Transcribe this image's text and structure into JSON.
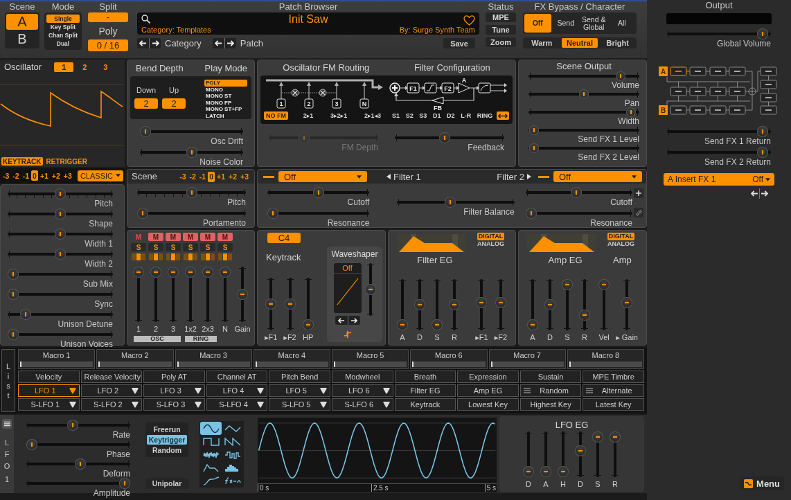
{
  "header": {
    "scene": {
      "title": "Scene",
      "options": [
        {
          "label": "A",
          "selected": true
        },
        {
          "label": "B",
          "selected": false
        }
      ]
    },
    "mode": {
      "title": "Mode",
      "options": [
        {
          "label": "Single",
          "selected": true
        },
        {
          "label": "Key Split",
          "selected": false
        },
        {
          "label": "Chan Split",
          "selected": false
        },
        {
          "label": "Dual",
          "selected": false
        }
      ]
    },
    "split": {
      "title": "Split",
      "value": "-"
    },
    "poly": {
      "title": "Poly",
      "value": "0 / 16"
    },
    "patch_browser": {
      "title": "Patch Browser",
      "patch_name": "Init Saw",
      "category": "Category: Templates",
      "author": "By: Surge Synth Team",
      "favorite": false,
      "nav": [
        {
          "label": "Category"
        },
        {
          "label": "Patch"
        }
      ],
      "save": "Save"
    },
    "status": {
      "title": "Status",
      "buttons": [
        "MPE",
        "Tune",
        "Zoom"
      ]
    },
    "fx_bypass": {
      "title": "FX Bypass / Character",
      "bypass": [
        {
          "label": "Off",
          "selected": true
        },
        {
          "label": "Send",
          "selected": false
        },
        {
          "label": "Send & Global",
          "selected": false
        },
        {
          "label": "All",
          "selected": false
        }
      ],
      "character": [
        {
          "label": "Warm",
          "selected": false
        },
        {
          "label": "Neutral",
          "selected": true
        },
        {
          "label": "Bright",
          "selected": false
        }
      ]
    }
  },
  "oscillator": {
    "title": "Oscillator",
    "tabs": [
      {
        "label": "1",
        "selected": true
      },
      {
        "label": "2",
        "selected": false
      },
      {
        "label": "3",
        "selected": false
      }
    ],
    "toggles": [
      {
        "label": "KEYTRACK",
        "on": true
      },
      {
        "label": "RETRIGGER",
        "on": false
      }
    ],
    "octave": [
      {
        "label": "-3",
        "selected": false
      },
      {
        "label": "-2",
        "selected": false
      },
      {
        "label": "-1",
        "selected": false
      },
      {
        "label": "0",
        "selected": true
      },
      {
        "label": "+1",
        "selected": false
      },
      {
        "label": "+2",
        "selected": false
      },
      {
        "label": "+3",
        "selected": false
      }
    ],
    "type": "CLASSIC",
    "sliders": [
      {
        "label": "Pitch",
        "level": 0.5,
        "kind": "stepped"
      },
      {
        "label": "Shape",
        "level": 0.5,
        "kind": "plain"
      },
      {
        "label": "Width 1",
        "level": 0.5,
        "kind": "plain"
      },
      {
        "label": "Width 2",
        "level": 0.5,
        "kind": "plain"
      },
      {
        "label": "Sub Mix",
        "level": 0,
        "kind": "plain"
      },
      {
        "label": "Sync",
        "level": 0,
        "kind": "plain"
      },
      {
        "label": "Unison Detune",
        "level": 0.13,
        "kind": "plain"
      },
      {
        "label": "Unison Voices",
        "level": 0,
        "kind": "plain"
      }
    ]
  },
  "voice": {
    "bend_title": "Bend Depth",
    "bend": [
      {
        "label": "Down",
        "value": "2"
      },
      {
        "label": "Up",
        "value": "2"
      }
    ],
    "play_title": "Play Mode",
    "play_modes": [
      {
        "label": "POLY",
        "selected": true
      },
      {
        "label": "MONO",
        "selected": false
      },
      {
        "label": "MONO ST",
        "selected": false
      },
      {
        "label": "MONO FP",
        "selected": false
      },
      {
        "label": "MONO ST+FP",
        "selected": false
      },
      {
        "label": "LATCH",
        "selected": false
      }
    ],
    "sliders": [
      {
        "label": "Osc Drift",
        "level": 0
      },
      {
        "label": "Noise Color",
        "level": 0.5
      }
    ]
  },
  "fm_routing": {
    "title": "Oscillator FM Routing",
    "nodes": [
      "1",
      "2",
      "3",
      "N"
    ],
    "options": [
      {
        "label": "NO FM",
        "selected": true
      },
      {
        "label": "2▸1",
        "selected": false
      },
      {
        "label": "3▸2▸1",
        "selected": false
      },
      {
        "label": "2▸1◂3",
        "selected": false
      }
    ],
    "depth": {
      "label": "FM Depth",
      "level": 0.3,
      "disabled": true
    }
  },
  "filter_config": {
    "title": "Filter Configuration",
    "nodes": {
      "filter_1": "F1",
      "filter_2": "F2",
      "amp": "A",
      "feedback": "FB"
    },
    "options": [
      {
        "label": "S1",
        "selected": false
      },
      {
        "label": "S2",
        "selected": false
      },
      {
        "label": "S3",
        "selected": false
      },
      {
        "label": "D1",
        "selected": false
      },
      {
        "label": "D2",
        "selected": false
      },
      {
        "label": "L-R",
        "selected": false
      },
      {
        "label": "RING",
        "selected": false
      }
    ],
    "wide": true,
    "feedback": {
      "label": "Feedback",
      "level": 0.45
    }
  },
  "scene_output": {
    "title": "Scene Output",
    "sliders": [
      {
        "label": "Volume",
        "level": 0.87
      },
      {
        "label": "Pan",
        "level": 0.5
      },
      {
        "label": "Width",
        "level": 0.97
      },
      {
        "label": "Send FX 1 Level",
        "level": 0
      },
      {
        "label": "Send FX 2 Level",
        "level": 0
      }
    ]
  },
  "scene": {
    "title": "Scene",
    "octave": [
      {
        "label": "-3",
        "selected": false
      },
      {
        "label": "-2",
        "selected": false
      },
      {
        "label": "-1",
        "selected": false
      },
      {
        "label": "0",
        "selected": true
      },
      {
        "label": "+1",
        "selected": false
      },
      {
        "label": "+2",
        "selected": false
      },
      {
        "label": "+3",
        "selected": false
      }
    ],
    "sliders": [
      {
        "label": "Pitch",
        "level": 0.5,
        "kind": "stepped"
      },
      {
        "label": "Portamento",
        "level": 0,
        "kind": "plain"
      }
    ]
  },
  "filters": {
    "units": [
      {
        "type": "Off",
        "label": "Filter 1",
        "sliders": [
          {
            "label": "Cutoff",
            "level": 0.5
          },
          {
            "label": "Resonance",
            "level": 0
          }
        ]
      },
      {
        "type": "Off",
        "label": "Filter 2",
        "sliders": [
          {
            "label": "Cutoff",
            "level": 0.47
          },
          {
            "label": "Resonance",
            "level": 0
          }
        ]
      }
    ],
    "balance": {
      "label": "Filter Balance",
      "level": 0.45
    }
  },
  "mixer": {
    "channels": [
      {
        "label": "1",
        "mute": {
          "label": "M",
          "on": false
        },
        "solo": {
          "label": "S",
          "on": false
        },
        "route": [
          {
            "selected": false
          },
          {
            "selected": true
          },
          {
            "selected": false
          }
        ],
        "level": 1
      },
      {
        "label": "2",
        "mute": {
          "label": "M",
          "on": true
        },
        "solo": {
          "label": "S",
          "on": false
        },
        "route": [
          {
            "selected": false
          },
          {
            "selected": true
          },
          {
            "selected": false
          }
        ],
        "level": 1
      },
      {
        "label": "3",
        "mute": {
          "label": "M",
          "on": true
        },
        "solo": {
          "label": "S",
          "on": false
        },
        "route": [
          {
            "selected": false
          },
          {
            "selected": true
          },
          {
            "selected": false
          }
        ],
        "level": 1
      },
      {
        "label": "1x2",
        "mute": {
          "label": "M",
          "on": true
        },
        "solo": {
          "label": "S",
          "on": false
        },
        "route": [
          {
            "selected": false
          },
          {
            "selected": true
          },
          {
            "selected": false
          }
        ],
        "level": 1
      },
      {
        "label": "2x3",
        "mute": {
          "label": "M",
          "on": true
        },
        "solo": {
          "label": "S",
          "on": false
        },
        "route": [
          {
            "selected": false
          },
          {
            "selected": true
          },
          {
            "selected": false
          }
        ],
        "level": 1
      },
      {
        "label": "N",
        "mute": {
          "label": "M",
          "on": true
        },
        "solo": {
          "label": "S",
          "on": false
        },
        "route": [
          {
            "selected": false
          },
          {
            "selected": true
          },
          {
            "selected": false
          }
        ],
        "level": 1
      }
    ],
    "gain": {
      "label": "Gain",
      "level": 0.5
    },
    "groups": [
      {
        "label": "OSC"
      },
      {
        "label": "RING"
      }
    ]
  },
  "keytrack": {
    "root": "C4",
    "title": "Keytrack",
    "sliders": [
      {
        "label": "▸F1",
        "level": 0.5
      },
      {
        "label": "▸F2",
        "level": 0.5
      },
      {
        "label": "HP",
        "level": 0
      }
    ]
  },
  "waveshaper": {
    "title": "Waveshaper",
    "type": "Off",
    "drive": {
      "level": 0.5
    }
  },
  "filter_eg": {
    "title": "Filter EG",
    "modes": [
      {
        "label": "DIGITAL",
        "selected": true
      },
      {
        "label": "ANALOG",
        "selected": false
      }
    ],
    "sliders": [
      {
        "label": "A",
        "level": 0
      },
      {
        "label": "D",
        "level": 0.5
      },
      {
        "label": "S",
        "level": 0
      },
      {
        "label": "R",
        "level": 0.5
      }
    ],
    "mods": [
      {
        "label": "▸F1",
        "level": 0.55
      },
      {
        "label": "▸F2",
        "level": 0.55
      }
    ]
  },
  "amp_eg": {
    "title": "Amp EG",
    "amp_title": "Amp",
    "modes": [
      {
        "label": "DIGITAL",
        "selected": true
      },
      {
        "label": "ANALOG",
        "selected": false
      }
    ],
    "sliders": [
      {
        "label": "A",
        "level": 0
      },
      {
        "label": "D",
        "level": 0.5
      },
      {
        "label": "S",
        "level": 1
      },
      {
        "label": "R",
        "level": 0.25
      }
    ],
    "mods": [
      {
        "label": "Vel",
        "level": 1
      },
      {
        "label": "▸ Gain",
        "level": 0.55
      }
    ]
  },
  "mod_list": {
    "label": "List",
    "macros": [
      {
        "label": "Macro 1",
        "level": 0
      },
      {
        "label": "Macro 2",
        "level": 0
      },
      {
        "label": "Macro 3",
        "level": 0
      },
      {
        "label": "Macro 4",
        "level": 0
      },
      {
        "label": "Macro 5",
        "level": 0
      },
      {
        "label": "Macro 6",
        "level": 0
      },
      {
        "label": "Macro 7",
        "level": 0
      },
      {
        "label": "Macro 8",
        "level": 0
      }
    ],
    "rows": [
      {
        "items": [
          {
            "label": "Velocity",
            "selected": false,
            "kind": "plain"
          },
          {
            "label": "Release Velocity",
            "selected": false,
            "kind": "plain"
          },
          {
            "label": "Poly AT",
            "selected": false,
            "kind": "plain"
          },
          {
            "label": "Channel AT",
            "selected": false,
            "kind": "plain"
          },
          {
            "label": "Pitch Bend",
            "selected": false,
            "kind": "plain"
          },
          {
            "label": "Modwheel",
            "selected": false,
            "kind": "plain"
          },
          {
            "label": "Breath",
            "selected": false,
            "kind": "plain"
          },
          {
            "label": "Expression",
            "selected": false,
            "kind": "plain"
          },
          {
            "label": "Sustain",
            "selected": false,
            "kind": "plain"
          },
          {
            "label": "MPE Timbre",
            "selected": false,
            "kind": "plain"
          }
        ]
      },
      {
        "items": [
          {
            "label": "LFO 1",
            "selected": true,
            "kind": "dropdown"
          },
          {
            "label": "LFO 2",
            "selected": false,
            "kind": "dropdown"
          },
          {
            "label": "LFO 3",
            "selected": false,
            "kind": "dropdown"
          },
          {
            "label": "LFO 4",
            "selected": false,
            "kind": "dropdown"
          },
          {
            "label": "LFO 5",
            "selected": false,
            "kind": "dropdown"
          },
          {
            "label": "LFO 6",
            "selected": false,
            "kind": "dropdown"
          },
          {
            "label": "Filter EG",
            "selected": false,
            "kind": "plain"
          },
          {
            "label": "Amp EG",
            "selected": false,
            "kind": "plain"
          },
          {
            "label": "Random",
            "selected": false,
            "kind": "menu"
          },
          {
            "label": "Alternate",
            "selected": false,
            "kind": "menu"
          }
        ]
      },
      {
        "items": [
          {
            "label": "S-LFO 1",
            "selected": false,
            "kind": "dropdown"
          },
          {
            "label": "S-LFO 2",
            "selected": false,
            "kind": "dropdown"
          },
          {
            "label": "S-LFO 3",
            "selected": false,
            "kind": "dropdown"
          },
          {
            "label": "S-LFO 4",
            "selected": false,
            "kind": "dropdown"
          },
          {
            "label": "S-LFO 5",
            "selected": false,
            "kind": "dropdown"
          },
          {
            "label": "S-LFO 6",
            "selected": false,
            "kind": "dropdown"
          },
          {
            "label": "Keytrack",
            "selected": false,
            "kind": "plain"
          },
          {
            "label": "Lowest Key",
            "selected": false,
            "kind": "plain"
          },
          {
            "label": "Highest Key",
            "selected": false,
            "kind": "plain"
          },
          {
            "label": "Latest Key",
            "selected": false,
            "kind": "plain"
          }
        ]
      }
    ]
  },
  "lfo": {
    "label": "LFO",
    "index": "1",
    "sliders": [
      {
        "label": "Rate",
        "level": 0.44
      },
      {
        "label": "Phase",
        "level": 0
      },
      {
        "label": "Deform",
        "level": 0.52
      },
      {
        "label": "Amplitude",
        "level": 1
      }
    ],
    "trigger": [
      {
        "label": "Freerun",
        "selected": false
      },
      {
        "label": "Keytrigger",
        "selected": true
      },
      {
        "label": "Random",
        "selected": false
      }
    ],
    "unipolar": {
      "label": "Unipolar",
      "on": false
    },
    "shapes": [
      {
        "kind": "sine",
        "selected": true
      },
      {
        "kind": "triangle",
        "selected": false
      },
      {
        "kind": "square",
        "selected": false
      },
      {
        "kind": "saw",
        "selected": false
      },
      {
        "kind": "noise",
        "selected": false
      },
      {
        "kind": "sample_hold",
        "selected": false
      },
      {
        "kind": "envelope",
        "selected": false
      },
      {
        "kind": "step_seq",
        "selected": false
      },
      {
        "kind": "mseg",
        "selected": false
      },
      {
        "kind": "formula",
        "selected": false
      }
    ],
    "display": {
      "x_labels": [
        "0 s",
        "2.5 s",
        "5 s"
      ]
    },
    "eg": {
      "title": "LFO EG",
      "sliders": [
        {
          "label": "D",
          "level": 0
        },
        {
          "label": "A",
          "level": 0
        },
        {
          "label": "H",
          "level": 0
        },
        {
          "label": "D",
          "level": 0.6
        },
        {
          "label": "S",
          "level": 1
        },
        {
          "label": "R",
          "level": 1
        }
      ]
    }
  },
  "output": {
    "title": "Output",
    "global_volume": {
      "label": "Global Volume",
      "level": 0.97
    },
    "routing": {
      "rows": [
        {
          "label": "A",
          "slots": [
            {
              "selected": true
            },
            {
              "selected": false
            },
            {
              "selected": false
            },
            {
              "selected": false
            }
          ]
        },
        {
          "slots": [
            {
              "selected": false
            },
            {
              "selected": false
            },
            {
              "selected": false
            },
            {
              "selected": false
            }
          ]
        },
        {
          "label": "B",
          "slots": [
            {
              "selected": false
            },
            {
              "selected": false
            },
            {
              "selected": false
            },
            {
              "selected": false
            }
          ]
        }
      ],
      "global_slots": [
        {
          "selected": false
        },
        {
          "selected": false
        },
        {
          "selected": false
        },
        {
          "selected": false
        }
      ]
    },
    "returns": [
      {
        "label": "Send FX 1 Return",
        "level": 0.97
      },
      {
        "label": "Send FX 2 Return",
        "level": 0.97
      }
    ],
    "insert": {
      "label": "A Insert FX 1",
      "value": "Off"
    }
  },
  "menu": {
    "label": "Menu"
  }
}
